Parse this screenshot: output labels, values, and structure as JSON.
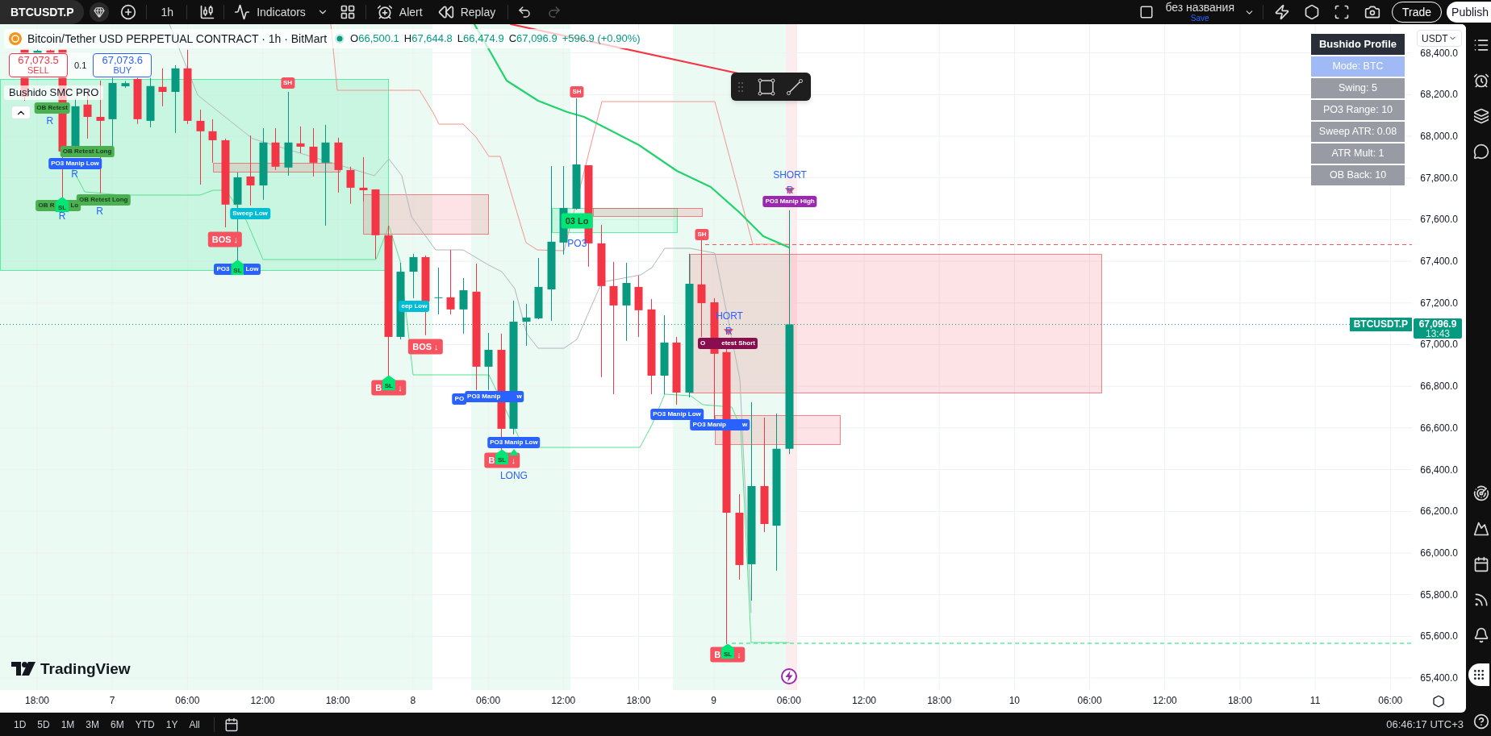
{
  "top_bar": {
    "symbol": "BTCUSDT.P",
    "interval": "1h",
    "tools": [
      {
        "label": "Indicators"
      },
      {
        "label": "Alert"
      },
      {
        "label": "Replay"
      }
    ],
    "layout_name": "без названия",
    "layout_status": "Save",
    "buttons": [
      {
        "label": "Trade",
        "kind": "outline"
      },
      {
        "label": "Publish",
        "kind": "solid"
      }
    ]
  },
  "legend": {
    "title": "Bitcoin/Tether USD PERPETUAL CONTRACT · 1h · BitMart",
    "values": [
      {
        "key": "O",
        "value": "66,500.1"
      },
      {
        "key": "H",
        "value": "67,644.8"
      },
      {
        "key": "L",
        "value": "66,474.9"
      },
      {
        "key": "C",
        "value": "67,096.9"
      }
    ],
    "change": "+596.9 (+0.90%)"
  },
  "order_buttons": [
    {
      "price": "67,073.5",
      "label": "SELL",
      "kind": "sell"
    },
    {
      "price": "67,073.6",
      "label": "BUY",
      "kind": "buy"
    }
  ],
  "spread": "0.1",
  "indicator": {
    "name": "Bushido SMC PRO"
  },
  "profile_table": {
    "title": "Bushido Profile",
    "rows": [
      {
        "text": "Mode: BTC",
        "highlighted": true
      },
      {
        "text": "Swing: 5",
        "highlighted": false
      },
      {
        "text": "PO3 Range: 10",
        "highlighted": false
      },
      {
        "text": "Sweep ATR: 0.08",
        "highlighted": false
      },
      {
        "text": "ATR Mult: 1",
        "highlighted": false
      },
      {
        "text": "OB Back: 10",
        "highlighted": false
      }
    ]
  },
  "currency": "USDT",
  "chart": {
    "logo_text": "TradingView",
    "price_tag": {
      "symbol": "BTCUSDT.P",
      "price": "67,096.9",
      "countdown": "13:43"
    },
    "price_axis": [
      "68,400.0",
      "68,200.0",
      "68,000.0",
      "67,800.0",
      "67,600.0",
      "67,400.0",
      "67,200.0",
      "67,000.0",
      "66,800.0",
      "66,600.0",
      "66,400.0",
      "66,200.0",
      "66,000.0",
      "65,800.0",
      "65,600.0",
      "65,400.0"
    ],
    "time_axis": [
      "18:00",
      "7",
      "06:00",
      "12:00",
      "18:00",
      "8",
      "06:00",
      "12:00",
      "18:00",
      "9",
      "06:00",
      "12:00",
      "18:00",
      "10",
      "06:00",
      "12:00",
      "18:00",
      "11",
      "06:00"
    ],
    "markers": [
      {
        "kind": "tag",
        "text": "OB Retest",
        "color": "#4caf50"
      },
      {
        "kind": "text",
        "text": "R",
        "color": "#2962ff"
      },
      {
        "kind": "tag",
        "text": "OB Retest Long",
        "color": "#4caf50"
      },
      {
        "kind": "label",
        "text": "PO3 Manip Low",
        "color": "#2962ff"
      },
      {
        "kind": "text",
        "text": "R",
        "color": "#2962ff"
      },
      {
        "kind": "tag",
        "text": "OB Retest Long",
        "color": "#4caf50"
      },
      {
        "kind": "tag",
        "parts": [
          "OB R",
          "Lo"
        ],
        "color": "#4caf50"
      },
      {
        "kind": "stop",
        "text": "SL",
        "color": "#00e676"
      },
      {
        "kind": "text",
        "text": "R",
        "color": "#2962ff"
      },
      {
        "kind": "text",
        "text": "R",
        "color": "#2962ff"
      },
      {
        "kind": "label",
        "text": "SH",
        "color": "#f7525f"
      },
      {
        "kind": "label",
        "text": "Sweep Low",
        "color": "#00bcd4"
      },
      {
        "kind": "badge",
        "text": "BOS ↓",
        "color": "#f7525f"
      },
      {
        "kind": "label",
        "parts": [
          "PO3",
          "Low"
        ],
        "color": "#2962ff"
      },
      {
        "kind": "stop",
        "text": "SL",
        "color": "#00e676"
      },
      {
        "kind": "label",
        "text": "eep Low",
        "color": "#00bcd4"
      },
      {
        "kind": "badge",
        "text": "BOS ↓",
        "color": "#f7525f"
      },
      {
        "kind": "badge",
        "parts": [
          "B",
          "↓"
        ],
        "color": "#f7525f"
      },
      {
        "kind": "stop",
        "text": "SL",
        "color": "#00e676"
      },
      {
        "kind": "label",
        "text": "PO",
        "color": "#2962ff"
      },
      {
        "kind": "label",
        "parts": [
          "PO3 Manip",
          "w"
        ],
        "color": "#2962ff"
      },
      {
        "kind": "label",
        "text": "PO3 Manip Low",
        "color": "#2962ff"
      },
      {
        "kind": "badge",
        "parts": [
          "B",
          "↓"
        ],
        "color": "#f7525f"
      },
      {
        "kind": "stop",
        "text": "SL",
        "color": "#00e676"
      },
      {
        "kind": "uptriangle",
        "color": "#00e676"
      },
      {
        "kind": "text",
        "text": "LONG",
        "color": "#2962ff"
      },
      {
        "kind": "label",
        "text": "SH",
        "color": "#f7525f"
      },
      {
        "kind": "block",
        "text": "03 Lo",
        "color": "#00e676"
      },
      {
        "kind": "text",
        "text": "PO3",
        "color": "#2962ff"
      },
      {
        "kind": "label",
        "text": "SH",
        "color": "#f7525f"
      },
      {
        "kind": "text",
        "text": "SHORT",
        "color": "#2962ff"
      },
      {
        "kind": "downtriangle",
        "color": "#f7525f"
      },
      {
        "kind": "text",
        "text": "R",
        "color": "#2962ff"
      },
      {
        "kind": "label",
        "text": "PO3 Manip High",
        "color": "#9c27b0"
      },
      {
        "kind": "text",
        "text": "HORT",
        "color": "#2962ff"
      },
      {
        "kind": "downtriangle",
        "color": "#f7525f"
      },
      {
        "kind": "text",
        "text": "R",
        "color": "#2962ff"
      },
      {
        "kind": "label",
        "parts": [
          "O",
          "etest Short"
        ],
        "color": "#880e4f"
      },
      {
        "kind": "label",
        "text": "PO3 Manip Low",
        "color": "#2962ff"
      },
      {
        "kind": "label",
        "parts": [
          "PO3 Manip",
          "w"
        ],
        "color": "#2962ff"
      },
      {
        "kind": "badge",
        "parts": [
          "B",
          "↓"
        ],
        "color": "#f7525f"
      },
      {
        "kind": "stop",
        "text": "SL",
        "color": "#00e676"
      },
      {
        "kind": "event"
      }
    ]
  },
  "bottom_bar": {
    "ranges": [
      "1D",
      "5D",
      "1M",
      "3M",
      "6M",
      "YTD",
      "1Y",
      "All"
    ],
    "clock": "06:46:17 UTC+3"
  }
}
